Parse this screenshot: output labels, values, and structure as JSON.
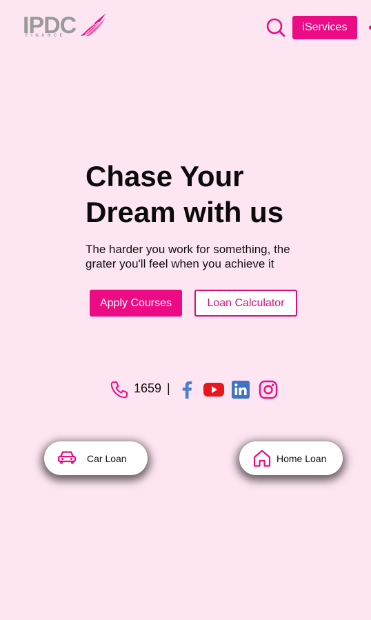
{
  "header": {
    "logo_text": "IPDC",
    "logo_subtext": "FINANCE",
    "iservices_label": "iServices",
    "search_icon": "search-icon"
  },
  "hero": {
    "title_line1": "Chase Your",
    "title_line2": "Dream with us",
    "subtitle_line1": "The harder you work for something, the",
    "subtitle_line2": "grater you'll feel when you achieve it",
    "apply_label": "Apply Courses",
    "calculator_label": "Loan Calculator"
  },
  "contact": {
    "phone_number": "1659",
    "separator": "|",
    "icons": [
      "phone-icon",
      "facebook-icon",
      "youtube-icon",
      "linkedin-icon",
      "instagram-icon"
    ]
  },
  "quick_links": {
    "car_loan_label": "Car Loan",
    "home_loan_label": "Home Loan"
  },
  "colors": {
    "background": "#fde6f1",
    "accent": "#ec0b85",
    "outline": "#d80f79",
    "facebook": "#4a7fd4",
    "youtube": "#e8171d",
    "linkedin": "#3f73c4"
  }
}
